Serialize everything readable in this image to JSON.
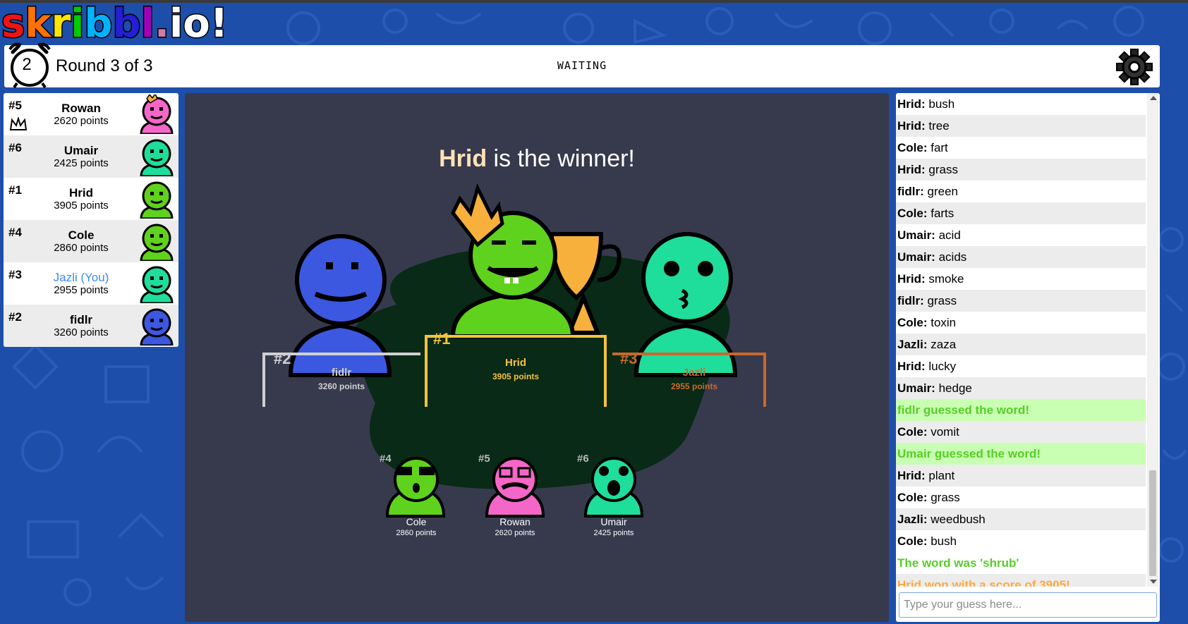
{
  "logo": {
    "letters": [
      "s",
      "k",
      "r",
      "i",
      "b",
      "b",
      "l",
      ".",
      "i",
      "o",
      "!"
    ],
    "colors": [
      "#ef1313",
      "#ff7100",
      "#ffe400",
      "#00cc00",
      "#00b2ff",
      "#231fd3",
      "#a300ba",
      "#d47aa4",
      "#ffffff",
      "#ffffff",
      "#ffffff"
    ]
  },
  "header": {
    "timer": "2",
    "round": "Round 3 of 3",
    "status": "WAITING",
    "settings_icon": "gear-icon"
  },
  "players": [
    {
      "rank": "#5",
      "name": "Rowan",
      "points": "2620 points",
      "me": false,
      "owner": true,
      "color": "#f467c8"
    },
    {
      "rank": "#6",
      "name": "Umair",
      "points": "2425 points",
      "me": false,
      "owner": false,
      "color": "#1fdd9b"
    },
    {
      "rank": "#1",
      "name": "Hrid",
      "points": "3905 points",
      "me": false,
      "owner": false,
      "color": "#5fd21d"
    },
    {
      "rank": "#4",
      "name": "Cole",
      "points": "2860 points",
      "me": false,
      "owner": false,
      "color": "#5fd21d"
    },
    {
      "rank": "#3",
      "name": "Jazli (You)",
      "points": "2955 points",
      "me": true,
      "owner": false,
      "color": "#1fdd9b"
    },
    {
      "rank": "#2",
      "name": "fidlr",
      "points": "3260 points",
      "me": false,
      "owner": false,
      "color": "#3c58e0"
    }
  ],
  "results": {
    "winner_name": "Hrid",
    "winner_suffix": " is the winner!",
    "podium": [
      {
        "rank": "#2",
        "name": "fidlr",
        "points": "3260 points",
        "color": "#d0d0d0"
      },
      {
        "rank": "#1",
        "name": "Hrid",
        "points": "3905 points",
        "color": "#f7c23c"
      },
      {
        "rank": "#3",
        "name": "Jazli",
        "points": "2955 points",
        "color": "#c8692d"
      }
    ],
    "others": [
      {
        "rank": "#4",
        "name": "Cole",
        "points": "2860 points"
      },
      {
        "rank": "#5",
        "name": "Rowan",
        "points": "2620 points"
      },
      {
        "rank": "#6",
        "name": "Umair",
        "points": "2425 points"
      }
    ]
  },
  "chat": {
    "messages": [
      {
        "type": "guess-text",
        "user": "Hrid:",
        "text": " bush"
      },
      {
        "type": "guess-text",
        "user": "Hrid:",
        "text": " tree"
      },
      {
        "type": "guess-text",
        "user": "Cole:",
        "text": " fart"
      },
      {
        "type": "guess-text",
        "user": "Hrid:",
        "text": " grass"
      },
      {
        "type": "guess-text",
        "user": "fidlr:",
        "text": " green"
      },
      {
        "type": "guess-text",
        "user": "Cole:",
        "text": " farts"
      },
      {
        "type": "guess-text",
        "user": "Umair:",
        "text": " acid"
      },
      {
        "type": "guess-text",
        "user": "Umair:",
        "text": " acids"
      },
      {
        "type": "guess-text",
        "user": "Hrid:",
        "text": " smoke"
      },
      {
        "type": "guess-text",
        "user": "fidlr:",
        "text": " grass"
      },
      {
        "type": "guess-text",
        "user": "Cole:",
        "text": " toxin"
      },
      {
        "type": "guess-text",
        "user": "Jazli:",
        "text": " zaza"
      },
      {
        "type": "guess-text",
        "user": "Hrid:",
        "text": " lucky"
      },
      {
        "type": "guess-text",
        "user": "Umair:",
        "text": " hedge"
      },
      {
        "type": "guessed",
        "user": "",
        "text": "fidlr guessed the word!"
      },
      {
        "type": "guess-text",
        "user": "Cole:",
        "text": " vomit"
      },
      {
        "type": "guessed",
        "user": "",
        "text": "Umair guessed the word!"
      },
      {
        "type": "guess-text",
        "user": "Hrid:",
        "text": " plant"
      },
      {
        "type": "guess-text",
        "user": "Cole:",
        "text": " grass"
      },
      {
        "type": "guess-text",
        "user": "Jazli:",
        "text": " weedbush"
      },
      {
        "type": "guess-text",
        "user": "Cole:",
        "text": " bush"
      },
      {
        "type": "word",
        "user": "",
        "text": "The word was 'shrub'"
      },
      {
        "type": "won",
        "user": "",
        "text": "Hrid won with a score of 3905!"
      }
    ],
    "input_placeholder": "Type your guess here..."
  }
}
